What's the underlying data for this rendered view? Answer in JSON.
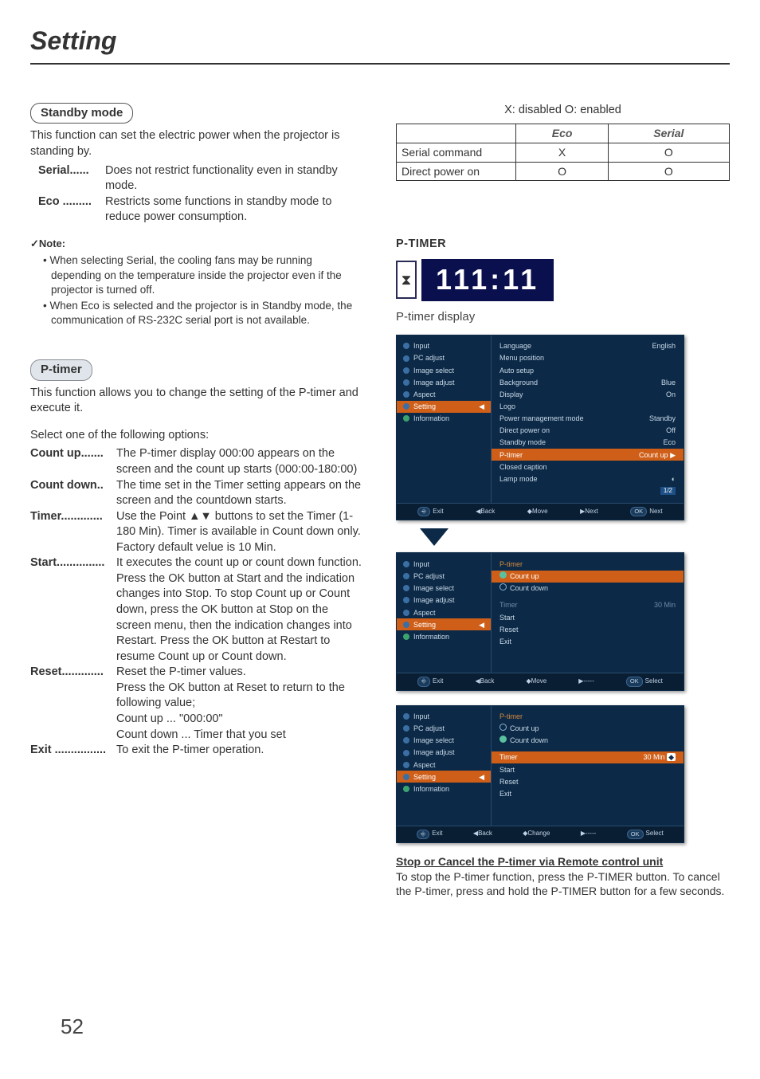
{
  "page": {
    "title": "Setting",
    "number": "52"
  },
  "standby": {
    "pill": "Standby mode",
    "intro": "This function can set the electric power when the projector is standing by.",
    "items": [
      {
        "term": "Serial......",
        "desc": "Does not restrict functionality even in standby mode."
      },
      {
        "term": "Eco .........",
        "desc": "Restricts some functions in standby mode to reduce power consumption."
      }
    ],
    "note_head": "✓Note:",
    "notes": [
      "When selecting Serial, the cooling fans may be running depending on the temperature inside the projector even if  the projector is turned off.",
      "When Eco is selected and the projector is in Standby mode, the communication of RS-232C serial port is not available."
    ]
  },
  "legend": "X: disabled    O: enabled",
  "table": {
    "headers": [
      "",
      "Eco",
      "Serial"
    ],
    "rows": [
      {
        "label": "Serial command",
        "eco": "X",
        "serial": "O"
      },
      {
        "label": "Direct  power on",
        "eco": "O",
        "serial": "O"
      }
    ]
  },
  "ptimer": {
    "pill": "P-timer",
    "intro": "This function allows you to change the setting of the P-timer and execute it.",
    "select_line": "Select one of the following options:",
    "items": [
      {
        "term": "Count up.......",
        "desc": "The P-timer display 000:00 appears on the screen and the count up starts (000:00-180:00)"
      },
      {
        "term": "Count down..",
        "desc": "The time set in the Timer setting appears on the screen and the countdown starts."
      },
      {
        "term": "Timer.............",
        "desc": "Use the Point ▲▼ buttons to set the Timer (1-180 Min). Timer is available in Count down only. Factory default velue is 10 Min."
      },
      {
        "term": "Start...............",
        "desc": "It executes the count up or count down function. Press the OK button at Start and the indication changes into Stop. To stop Count up or Count down, press the OK button at Stop on the screen menu, then the indication changes into Restart. Press the OK button at Restart to resume Count up or Count down."
      },
      {
        "term": "Reset.............",
        "desc": "Reset the P-timer values.\nPress the OK button at Reset to return to the following value;\nCount up ... \"000:00\"\nCount down ... Timer that you set"
      },
      {
        "term": "Exit ................",
        "desc": "To exit the P-timer operation."
      }
    ]
  },
  "ptimer_panel": {
    "heading": "P-TIMER",
    "value": "111:11",
    "caption": "P-timer display"
  },
  "osd_left": [
    "Input",
    "PC adjust",
    "Image select",
    "Image adjust",
    "Aspect",
    "Setting",
    "Information"
  ],
  "osd1_right": [
    {
      "l": "Language",
      "r": "English"
    },
    {
      "l": "Menu position",
      "r": ""
    },
    {
      "l": "Auto setup",
      "r": ""
    },
    {
      "l": "Background",
      "r": "Blue"
    },
    {
      "l": "Display",
      "r": "On"
    },
    {
      "l": "Logo",
      "r": ""
    },
    {
      "l": "Power management mode",
      "r": "Standby"
    },
    {
      "l": "Direct power on",
      "r": "Off"
    },
    {
      "l": "Standby mode",
      "r": "Eco"
    },
    {
      "l": "P-timer",
      "r": "Count up  ▶",
      "hi": true
    },
    {
      "l": "Closed caption",
      "r": ""
    },
    {
      "l": "Lamp mode",
      "r": "◐"
    }
  ],
  "osd1_pager": "1/2",
  "osd1_footer": [
    "Exit",
    "◀Back",
    "◆Move",
    "▶Next",
    "Next"
  ],
  "osd2": {
    "head": "P-timer",
    "options": [
      {
        "label": "Count up",
        "selected": true
      },
      {
        "label": "Count down",
        "selected": false
      }
    ],
    "rows": [
      {
        "l": "Timer",
        "r": "30 Min"
      },
      {
        "l": "Start",
        "r": ""
      },
      {
        "l": "Reset",
        "r": ""
      },
      {
        "l": "Exit",
        "r": ""
      }
    ],
    "footer": [
      "Exit",
      "◀Back",
      "◆Move",
      "▶-----",
      "Select"
    ]
  },
  "osd3": {
    "head": "P-timer",
    "options": [
      {
        "label": "Count up",
        "selected": false
      },
      {
        "label": "Count down",
        "selected": true
      }
    ],
    "rows": [
      {
        "l": "Timer",
        "r": "30 Min",
        "hi": true,
        "slider": true
      },
      {
        "l": "Start",
        "r": ""
      },
      {
        "l": "Reset",
        "r": ""
      },
      {
        "l": "Exit",
        "r": ""
      }
    ],
    "footer": [
      "Exit",
      "◀Back",
      "◆Change",
      "▶-----",
      "Select"
    ]
  },
  "stop_cancel": {
    "title": "Stop or Cancel the P-timer via Remote control unit",
    "body": "To stop the P-timer function, press the P-TIMER button. To cancel the P-timer, press and hold the P-TIMER button for a few seconds."
  }
}
